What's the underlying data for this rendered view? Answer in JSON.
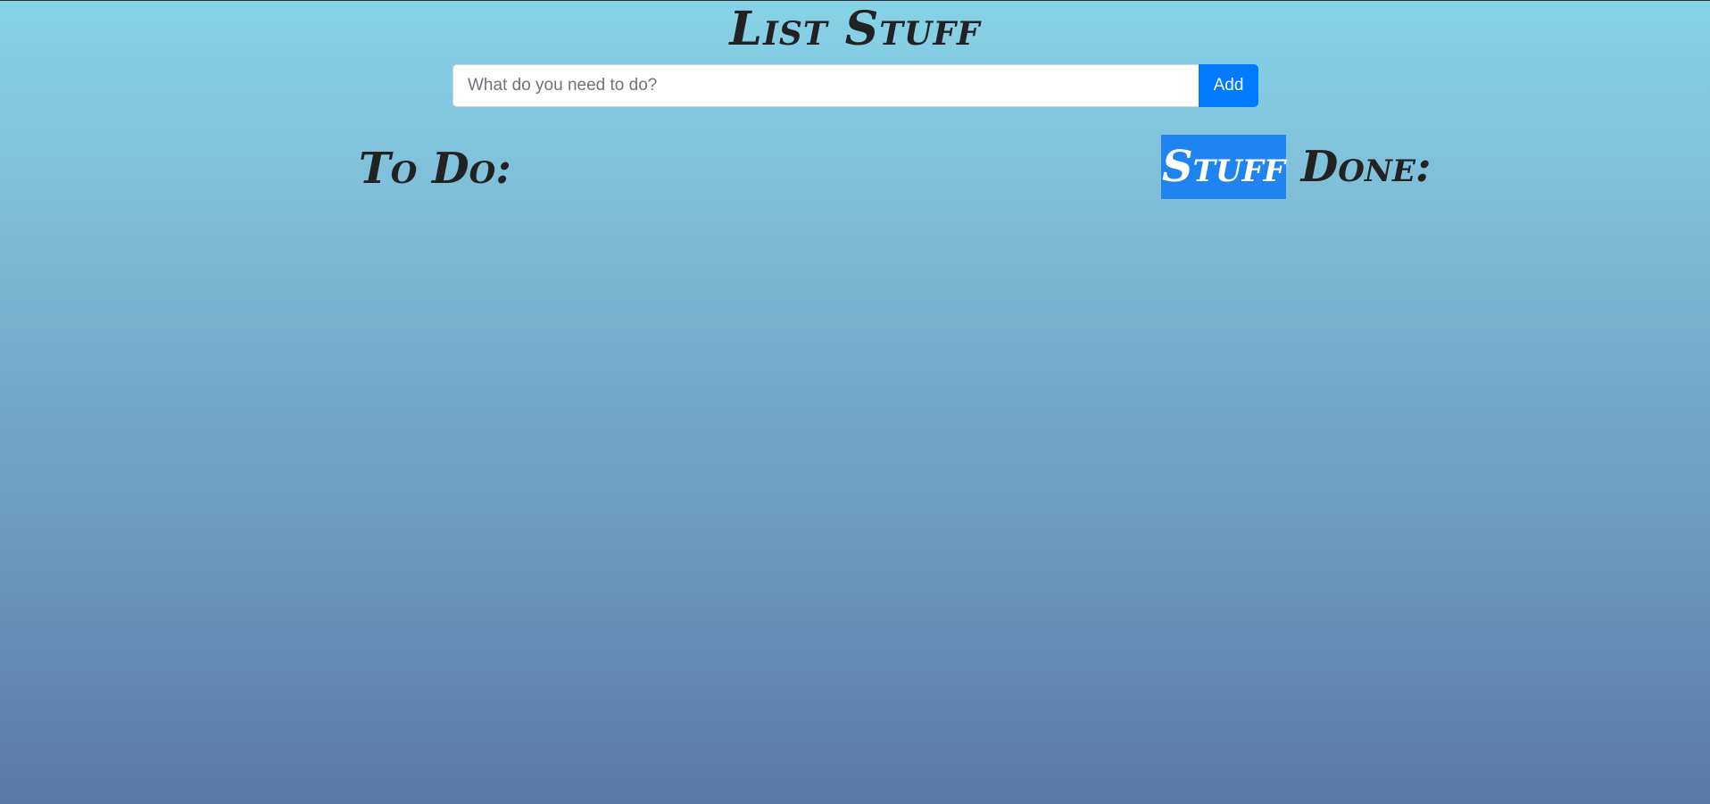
{
  "app": {
    "title": "List Stuff"
  },
  "add_form": {
    "input_value": "",
    "input_placeholder": "What do you need to do?",
    "add_label": "Add"
  },
  "columns": {
    "todo": {
      "heading": "To Do:",
      "items": []
    },
    "done": {
      "heading_highlighted": "Stuff",
      "heading_rest": " Done:",
      "items": []
    }
  },
  "colors": {
    "accent": "#007bff",
    "selection": "#1f83f0",
    "gradient_top": "#87d3e8",
    "gradient_bottom": "#5a7aa6",
    "text": "#222222"
  }
}
